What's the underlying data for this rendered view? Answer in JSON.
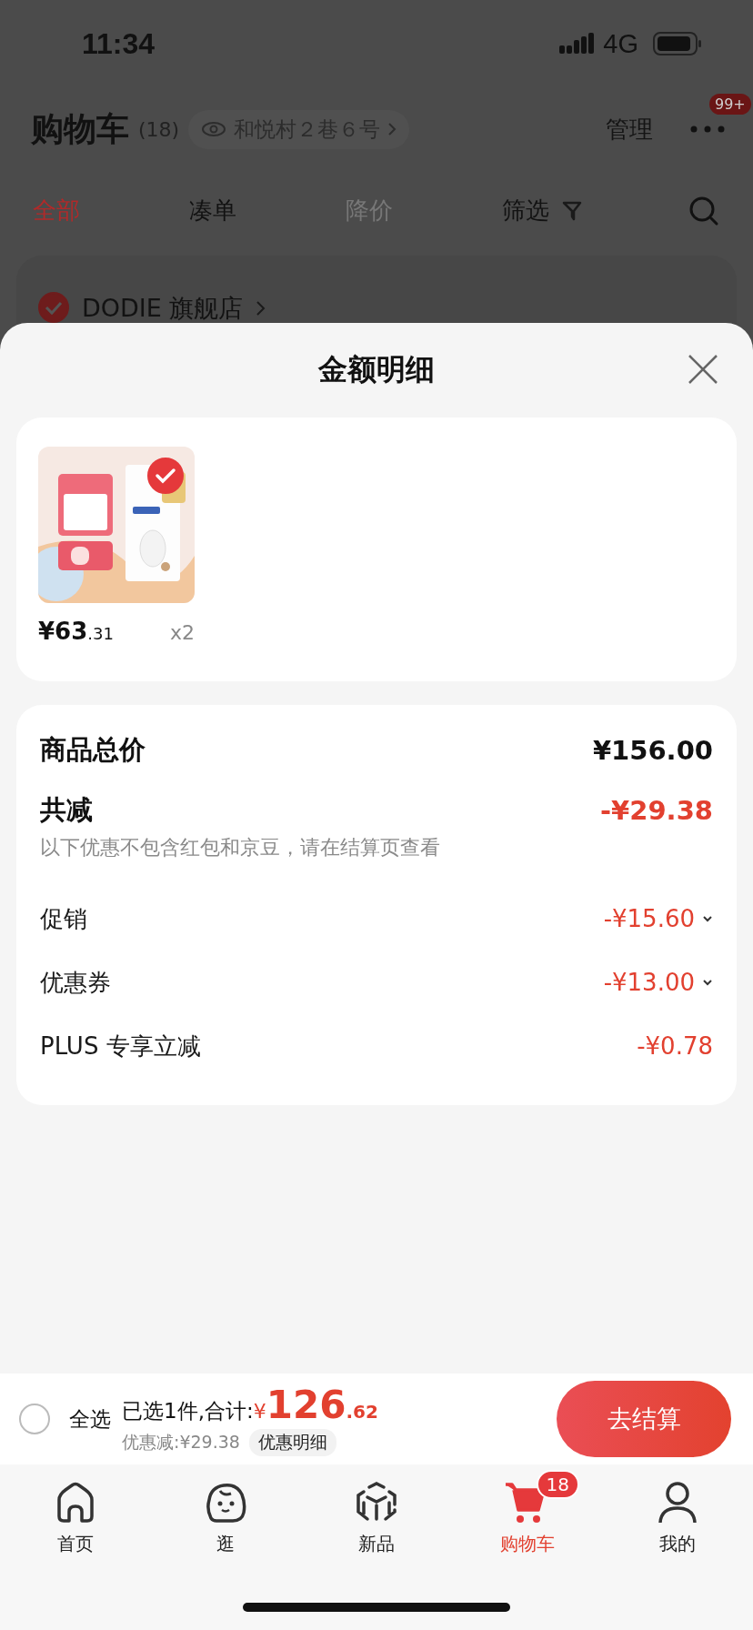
{
  "status_bar": {
    "time": "11:34",
    "network": "4G"
  },
  "header": {
    "title": "购物车",
    "count": "(18)",
    "address": "和悦村２巷６号",
    "manage": "管理",
    "more_badge": "99+"
  },
  "tabs": [
    {
      "label": "全部",
      "selected": true,
      "disabled": false,
      "kind": "plain"
    },
    {
      "label": "凑单",
      "selected": false,
      "disabled": false,
      "kind": "plain"
    },
    {
      "label": "降价",
      "selected": false,
      "disabled": true,
      "kind": "plain"
    },
    {
      "label": "筛选",
      "selected": false,
      "disabled": false,
      "kind": "filter"
    }
  ],
  "store": {
    "name": "DODIE 旗舰店",
    "checked": true
  },
  "sheet": {
    "title": "金额明细",
    "products": [
      {
        "selected": true,
        "price_main": "¥63",
        "price_decimal": ".31",
        "quantity": "x2",
        "kind": "picture"
      }
    ],
    "total": {
      "label": "商品总价",
      "value": "¥156.00"
    },
    "discount": {
      "label": "共减",
      "value": "-¥29.38",
      "note": "以下优惠不包含红包和京豆，请在结算页查看"
    },
    "lines": [
      {
        "label": "促销",
        "value": "-¥15.60",
        "kind": "dropdown"
      },
      {
        "label": "优惠券",
        "value": "-¥13.00",
        "kind": "dropdown"
      },
      {
        "label": "PLUS 专享立减",
        "value": "-¥0.78",
        "kind": "plain"
      }
    ]
  },
  "checkout_bar": {
    "select_all": {
      "label": "全选",
      "checked": false
    },
    "summary": "已选1件,合计:",
    "currency": "¥",
    "amount_main": "126",
    "amount_decimal": ".62",
    "saved": "优惠减:¥29.38",
    "detail_link": "优惠明细",
    "button": "去结算"
  },
  "nav": [
    {
      "label": "首页",
      "kind": "home",
      "selected": false
    },
    {
      "label": "逛",
      "kind": "browse",
      "selected": false
    },
    {
      "label": "新品",
      "kind": "new",
      "selected": false
    },
    {
      "label": "购物车",
      "kind": "cart",
      "selected": true,
      "badge": "18"
    },
    {
      "label": "我的",
      "kind": "me",
      "selected": false
    }
  ]
}
